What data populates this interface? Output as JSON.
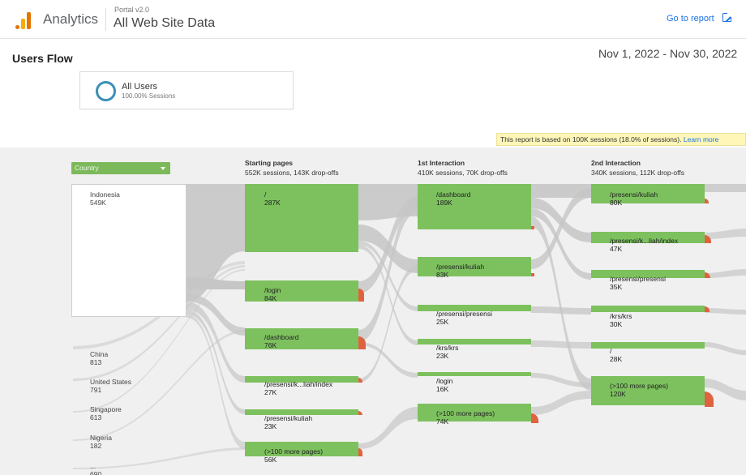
{
  "header": {
    "app_name": "Analytics",
    "portal_version": "Portal v2.0",
    "view_name": "All Web Site Data",
    "goto_report": "Go to report"
  },
  "page": {
    "title": "Users Flow",
    "date_range": "Nov 1, 2022 - Nov 30, 2022"
  },
  "segment": {
    "name": "All Users",
    "sessions_pct": "100.00% Sessions"
  },
  "sampling_note": {
    "text": "This report is based on 100K sessions (18.0% of sessions).",
    "link": "Learn more"
  },
  "dimension": {
    "selected": "Country"
  },
  "columns": [
    {
      "title": "Starting pages",
      "summary": "552K sessions, 143K drop-offs"
    },
    {
      "title": "1st Interaction",
      "summary": "410K sessions, 70K drop-offs"
    },
    {
      "title": "2nd Interaction",
      "summary": "340K sessions, 112K drop-offs"
    }
  ],
  "countries": [
    {
      "name": "Indonesia",
      "value": "549K"
    },
    {
      "name": "China",
      "value": "813"
    },
    {
      "name": "United States",
      "value": "791"
    },
    {
      "name": "Singapore",
      "value": "613"
    },
    {
      "name": "Nigeria",
      "value": "182"
    },
    {
      "name": "...",
      "value": "690"
    }
  ],
  "starting_pages": [
    {
      "page": "/",
      "value": "287K"
    },
    {
      "page": "/login",
      "value": "84K"
    },
    {
      "page": "/dashboard",
      "value": "76K"
    },
    {
      "page": "/presensi/k...liah/index",
      "value": "27K"
    },
    {
      "page": "/presensi/kuliah",
      "value": "23K"
    },
    {
      "page": "(>100 more pages)",
      "value": "56K"
    }
  ],
  "first_interaction": [
    {
      "page": "/dashboard",
      "value": "189K"
    },
    {
      "page": "/presensi/kuliah",
      "value": "83K"
    },
    {
      "page": "/presensi/presensi",
      "value": "25K"
    },
    {
      "page": "/krs/krs",
      "value": "23K"
    },
    {
      "page": "/login",
      "value": "16K"
    },
    {
      "page": "(>100 more pages)",
      "value": "74K"
    }
  ],
  "second_interaction": [
    {
      "page": "/presensi/kuliah",
      "value": "80K"
    },
    {
      "page": "/presensi/k...liah/index",
      "value": "47K"
    },
    {
      "page": "/presensi/presensi",
      "value": "35K"
    },
    {
      "page": "/krs/krs",
      "value": "30K"
    },
    {
      "page": "/",
      "value": "28K"
    },
    {
      "page": "(>100 more pages)",
      "value": "120K"
    }
  ],
  "colors": {
    "node_green": "#7cc15e",
    "dropoff_red": "#e0633f",
    "flow_gray": "#c4c4c4",
    "link_blue": "#1a73e8"
  }
}
